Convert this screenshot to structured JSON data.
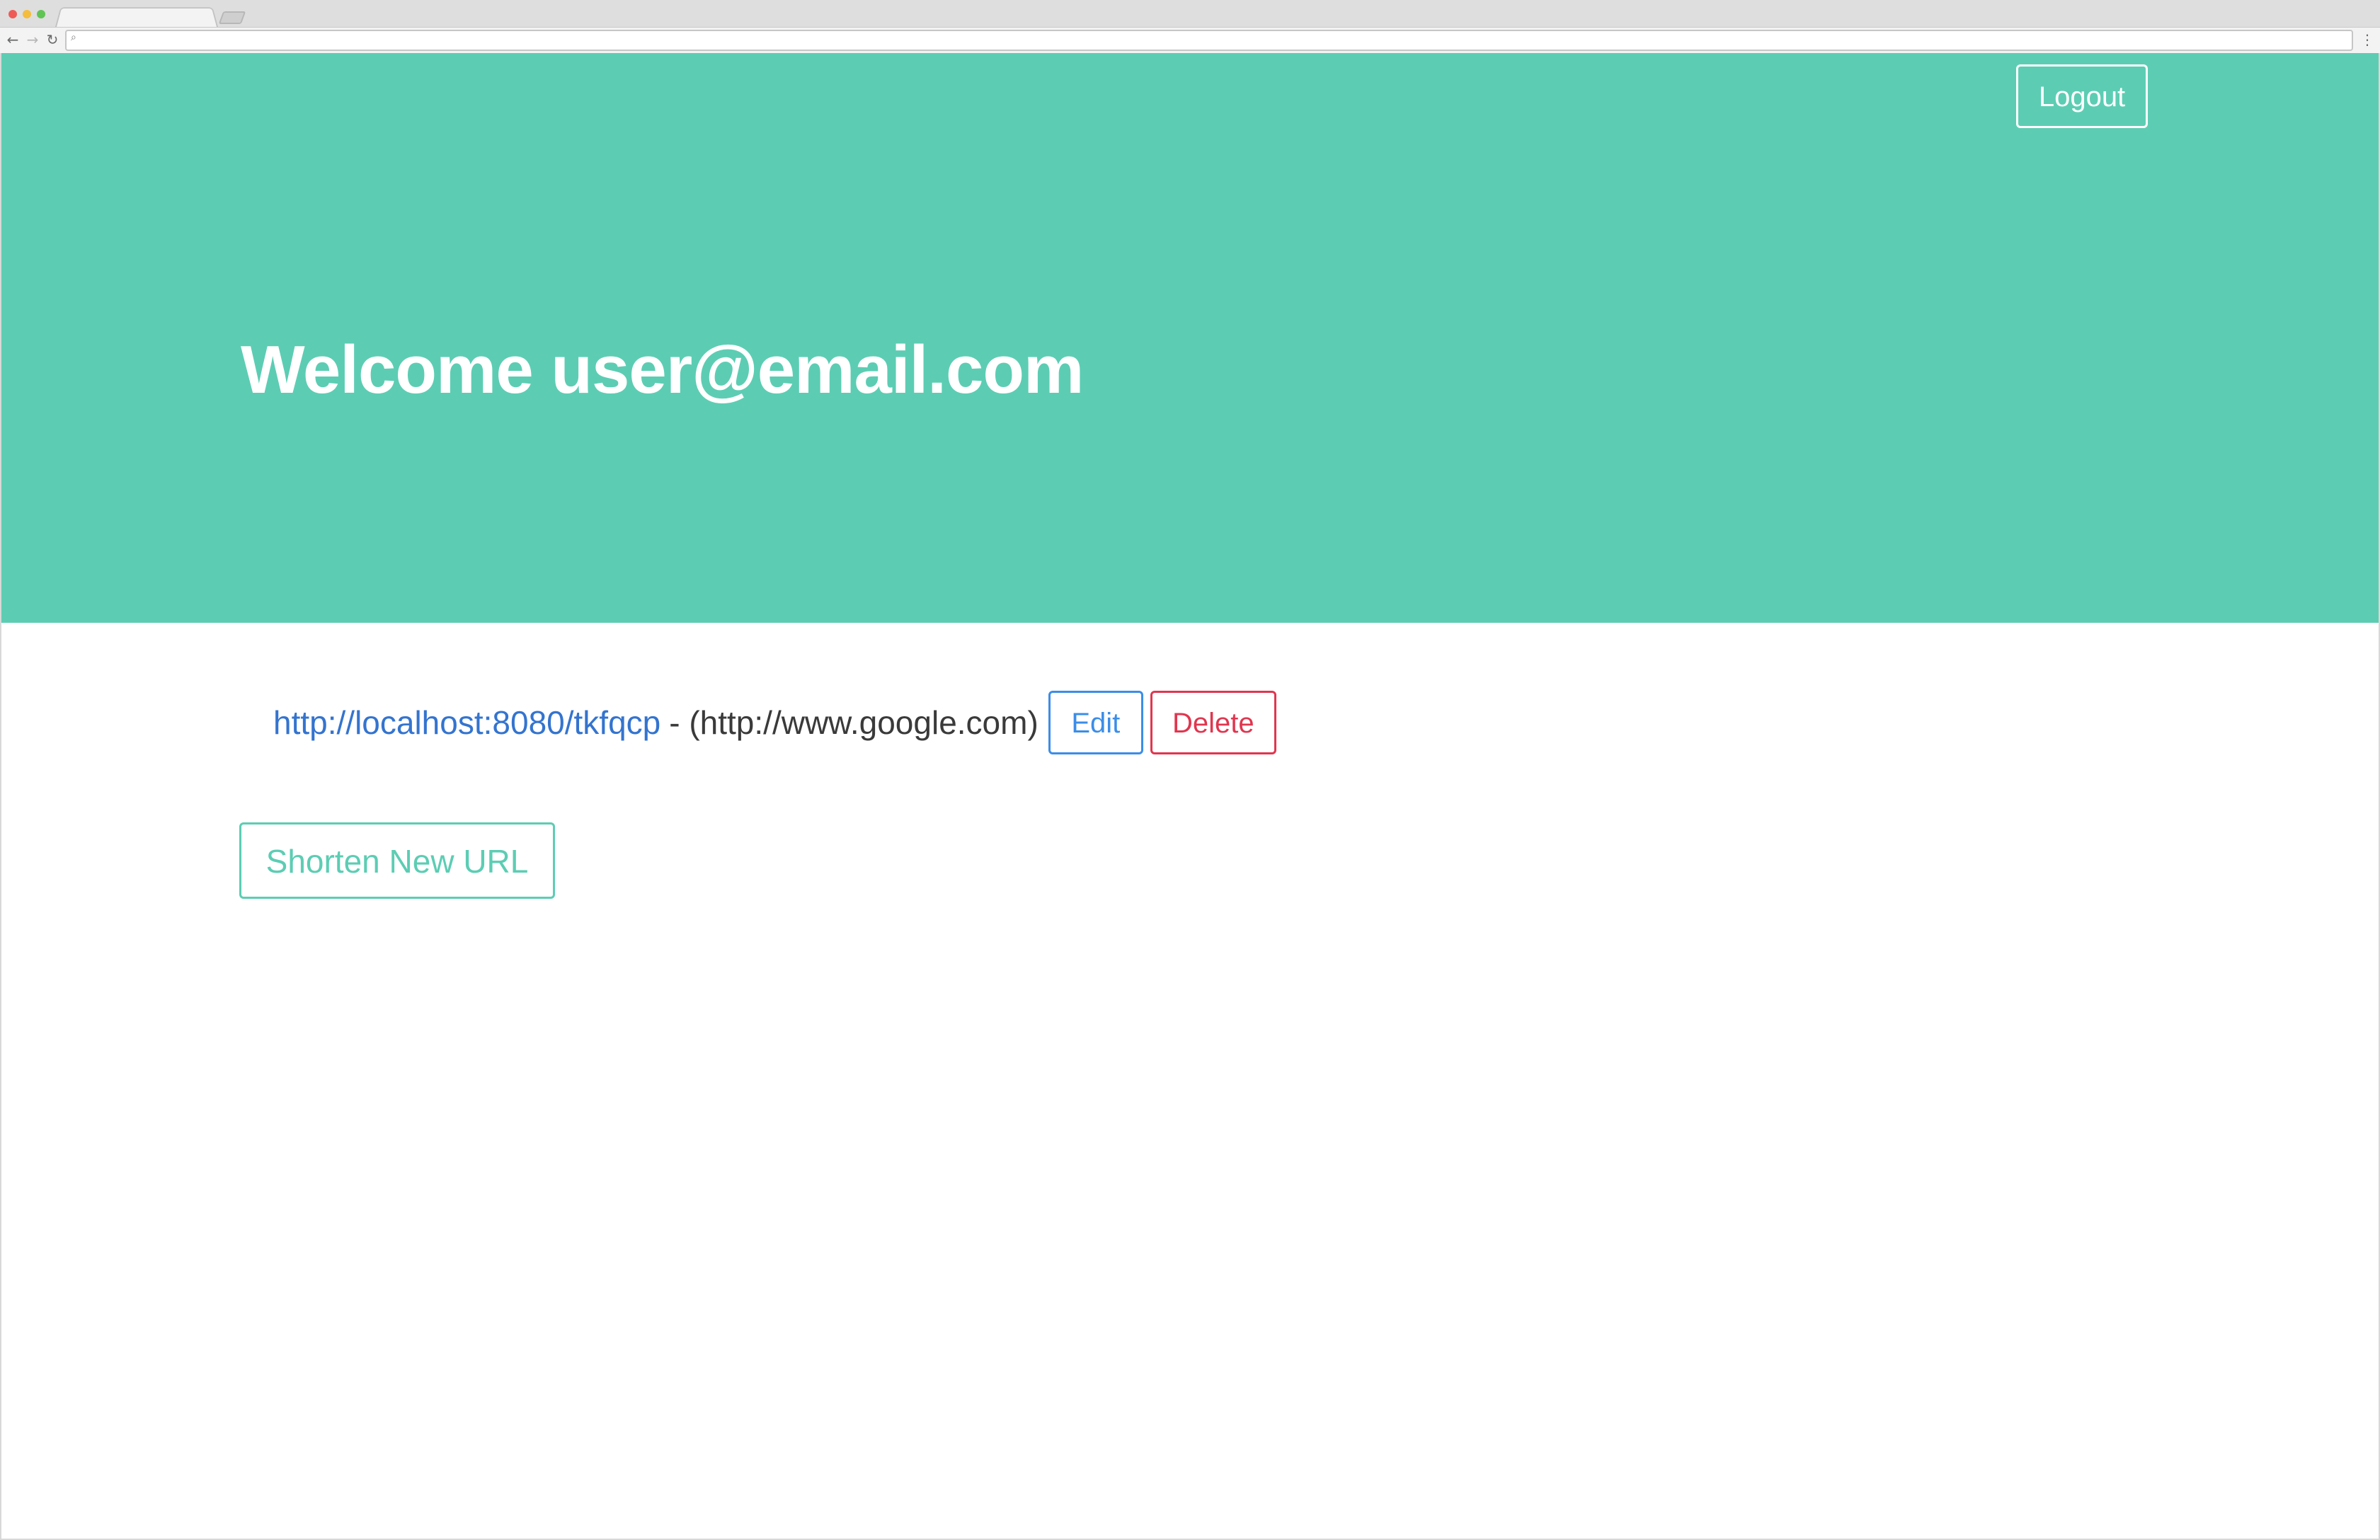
{
  "browser": {
    "search_icon": "search-icon",
    "back_icon": "←",
    "forward_icon": "→",
    "reload_icon": "↻",
    "menu_icon": "⋮",
    "address_value": ""
  },
  "header": {
    "logout_label": "Logout",
    "welcome_text": "Welcome user@email.com",
    "background_color": "#5ccdb3"
  },
  "urls": [
    {
      "short_url": "http://localhost:8080/tkfqcp",
      "long_url_display": "- (http://www.google.com)",
      "edit_label": "Edit",
      "delete_label": "Delete"
    }
  ],
  "actions": {
    "shorten_label": "Shorten New URL"
  },
  "colors": {
    "accent": "#5ccdb3",
    "link": "#3474cf",
    "edit": "#3b8de8",
    "delete": "#e0364f"
  }
}
